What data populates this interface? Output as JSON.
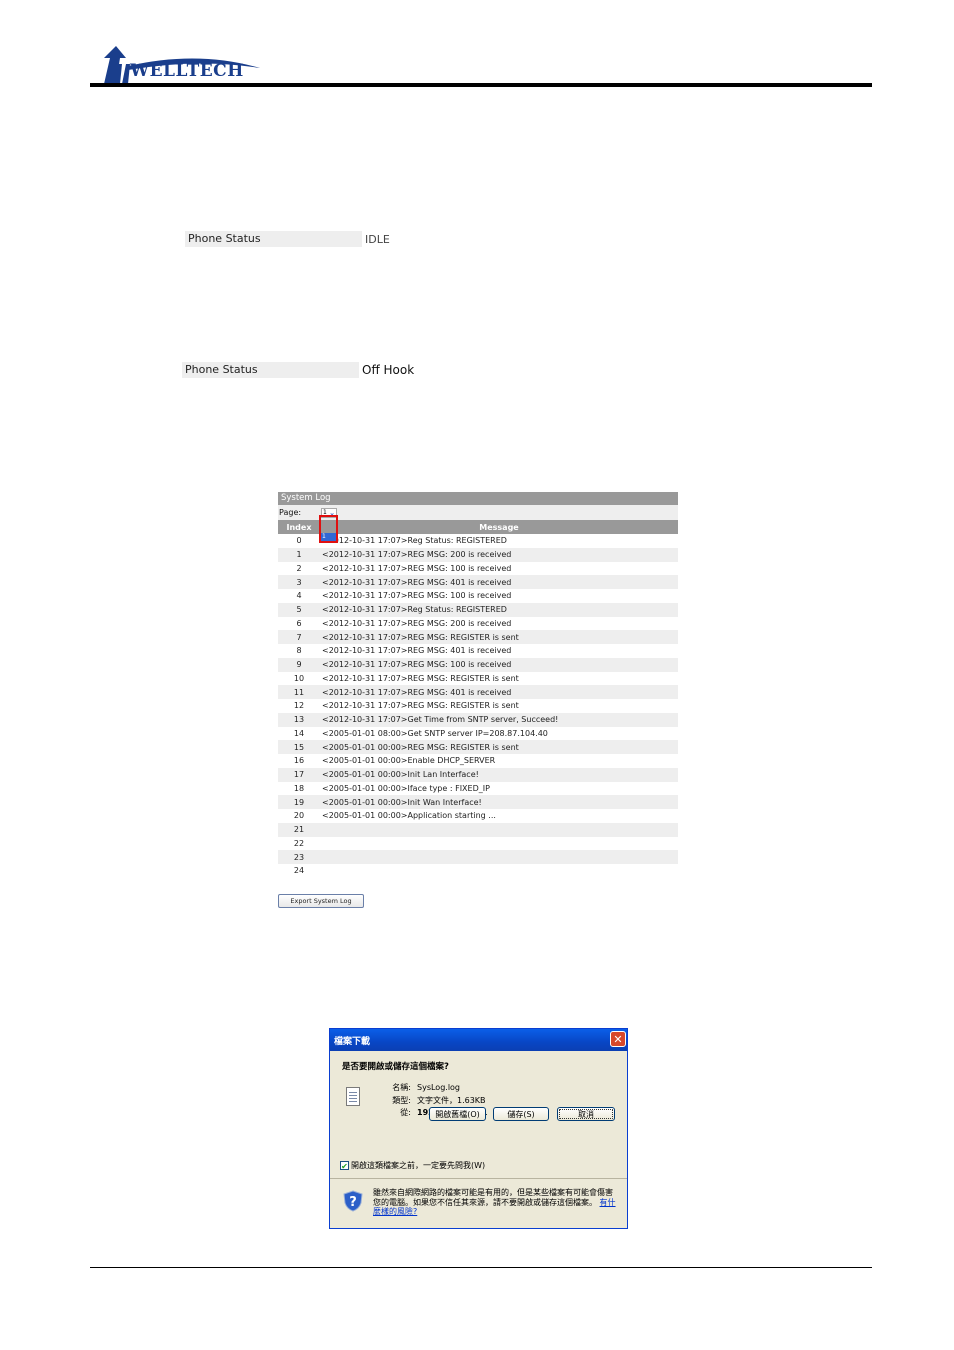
{
  "header": {
    "logo_text": "WELLTECH"
  },
  "phone_status_idle": {
    "label": "Phone Status",
    "value": "IDLE"
  },
  "phone_status_offhook": {
    "label": "Phone Status",
    "value": "Off Hook"
  },
  "system_log": {
    "title": "System Log",
    "page_label": "Page:",
    "page_selected": "1",
    "page_options": [
      "1"
    ],
    "columns": [
      "Index",
      "Message"
    ],
    "rows": [
      {
        "index": "0",
        "message": "<2012-10-31 17:07>Reg Status: REGISTERED"
      },
      {
        "index": "1",
        "message": "<2012-10-31 17:07>REG MSG: 200 is received"
      },
      {
        "index": "2",
        "message": "<2012-10-31 17:07>REG MSG: 100 is received"
      },
      {
        "index": "3",
        "message": "<2012-10-31 17:07>REG MSG: 401 is received"
      },
      {
        "index": "4",
        "message": "<2012-10-31 17:07>REG MSG: 100 is received"
      },
      {
        "index": "5",
        "message": "<2012-10-31 17:07>Reg Status: REGISTERED"
      },
      {
        "index": "6",
        "message": "<2012-10-31 17:07>REG MSG: 200 is received"
      },
      {
        "index": "7",
        "message": "<2012-10-31 17:07>REG MSG: REGISTER is sent"
      },
      {
        "index": "8",
        "message": "<2012-10-31 17:07>REG MSG: 401 is received"
      },
      {
        "index": "9",
        "message": "<2012-10-31 17:07>REG MSG: 100 is received"
      },
      {
        "index": "10",
        "message": "<2012-10-31 17:07>REG MSG: REGISTER is sent"
      },
      {
        "index": "11",
        "message": "<2012-10-31 17:07>REG MSG: 401 is received"
      },
      {
        "index": "12",
        "message": "<2012-10-31 17:07>REG MSG: REGISTER is sent"
      },
      {
        "index": "13",
        "message": "<2012-10-31 17:07>Get Time from SNTP server, Succeed!"
      },
      {
        "index": "14",
        "message": "<2005-01-01 08:00>Get SNTP server IP=208.87.104.40"
      },
      {
        "index": "15",
        "message": "<2005-01-01 00:00>REG MSG: REGISTER is sent"
      },
      {
        "index": "16",
        "message": "<2005-01-01 00:00>Enable DHCP_SERVER"
      },
      {
        "index": "17",
        "message": "<2005-01-01 00:00>Init Lan Interface!"
      },
      {
        "index": "18",
        "message": "<2005-01-01 00:00>Iface type : FIXED_IP"
      },
      {
        "index": "19",
        "message": "<2005-01-01 00:00>Init Wan Interface!"
      },
      {
        "index": "20",
        "message": "<2005-01-01 00:00>Application starting ..."
      },
      {
        "index": "21",
        "message": ""
      },
      {
        "index": "22",
        "message": ""
      },
      {
        "index": "23",
        "message": ""
      },
      {
        "index": "24",
        "message": ""
      }
    ],
    "export_button": "Export System Log"
  },
  "download_dialog": {
    "title": "檔案下載",
    "close_glyph": "✕",
    "question": "是否要開啟或儲存這個檔案?",
    "name_label": "名稱:",
    "name_value": "SysLog.log",
    "type_label": "類型:",
    "type_value": "文字文件，1.63KB",
    "from_label": "從:",
    "from_value": "192.168.22.121",
    "open_button": "開啟舊檔(O)",
    "save_button": "儲存(S)",
    "cancel_button": "取消",
    "checkbox_checked": true,
    "checkbox_label": "開啟這類檔案之前，一定要先問我(W)",
    "warning_text": "雖然來自網際網路的檔案可能是有用的，但是某些檔案有可能會傷害您的電腦。如果您不信任其來源，請不要開啟或儲存這個檔案。",
    "warning_link": "有什麼樣的風險?"
  }
}
